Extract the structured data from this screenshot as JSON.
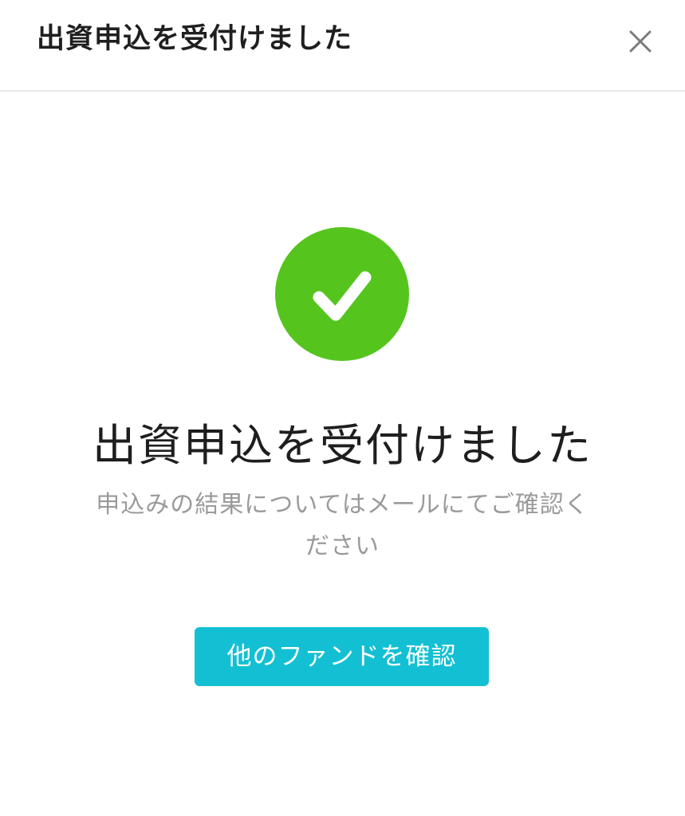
{
  "header": {
    "title": "出資申込を受付けました",
    "close_icon": "close-icon"
  },
  "success": {
    "icon": "checkmark-icon",
    "circle_color": "#55c51e"
  },
  "main": {
    "heading": "出資申込を受付けました",
    "message": "申込みの結果についてはメールにてご確認ください"
  },
  "actions": {
    "primary_label": "他のファンドを確認",
    "primary_color": "#13c0d3"
  }
}
